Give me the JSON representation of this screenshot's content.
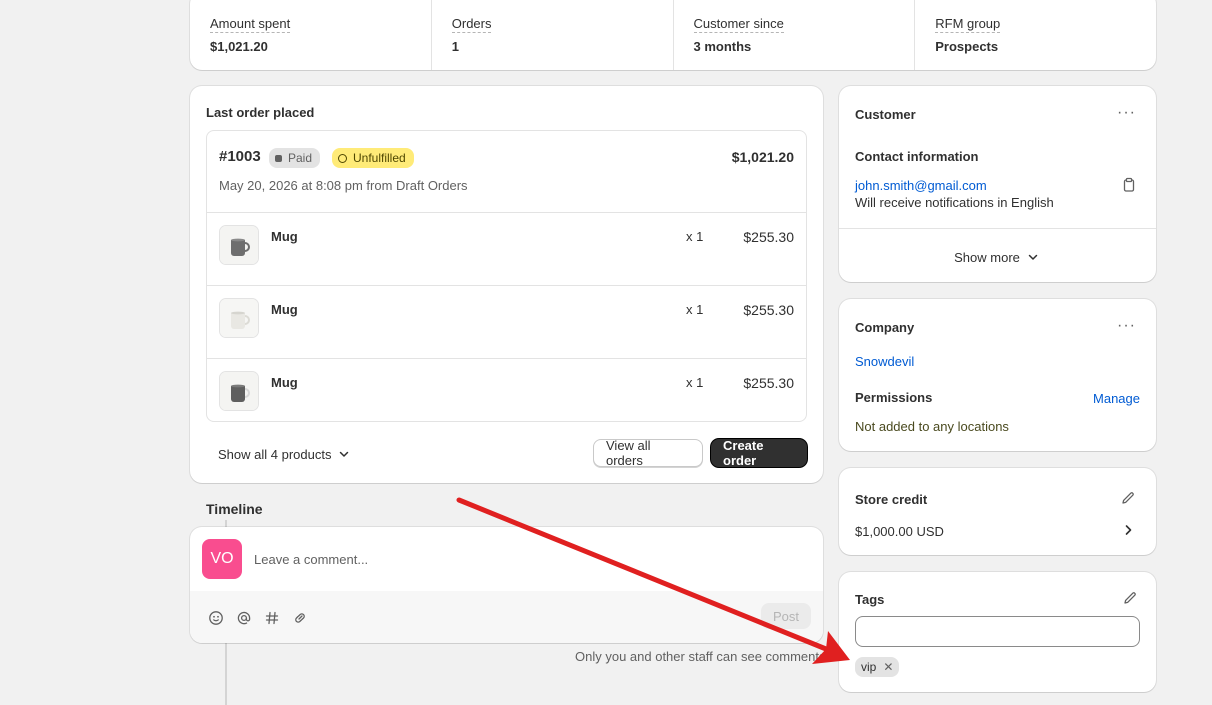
{
  "stats": [
    {
      "label": "Amount spent",
      "value": "$1,021.20"
    },
    {
      "label": "Orders",
      "value": "1"
    },
    {
      "label": "Customer since",
      "value": "3 months"
    },
    {
      "label": "RFM group",
      "value": "Prospects"
    }
  ],
  "last_order": {
    "title": "Last order placed",
    "number": "#1003",
    "payment_badge": "Paid",
    "fulfillment_badge": "Unfulfilled",
    "total": "$1,021.20",
    "date_line": "May 20, 2026 at 8:08 pm from Draft Orders",
    "items": [
      {
        "name": "Mug",
        "qty": "x 1",
        "price": "$255.30",
        "icon": "gray-mug-thumbnail"
      },
      {
        "name": "Mug",
        "qty": "x 1",
        "price": "$255.30",
        "icon": "white-mug-thumbnail"
      },
      {
        "name": "Mug",
        "qty": "x 1",
        "price": "$255.30",
        "icon": "gray-mug-thumbnail"
      }
    ],
    "show_all_label": "Show all 4 products",
    "view_all_label": "View all orders",
    "create_order_label": "Create order"
  },
  "timeline": {
    "title": "Timeline",
    "avatar_initials": "VO",
    "comment_placeholder": "Leave a comment...",
    "post_label": "Post",
    "staff_note": "Only you and other staff can see comments"
  },
  "customer": {
    "title": "Customer",
    "contact_heading": "Contact information",
    "email": "john.smith@gmail.com",
    "notification_note": "Will receive notifications in English",
    "show_more_label": "Show more"
  },
  "company": {
    "title": "Company",
    "name": "Snowdevil",
    "permissions_heading": "Permissions",
    "manage_label": "Manage",
    "permissions_note": "Not added to any locations"
  },
  "store_credit": {
    "title": "Store credit",
    "amount": "$1,000.00 USD"
  },
  "tags": {
    "title": "Tags",
    "input_value": "",
    "chips": [
      "vip"
    ]
  },
  "colors": {
    "accent_link": "#005bd3",
    "primary_button": "#303030",
    "avatar_bg": "#f94d8f",
    "unfulfilled_badge": "#ffeb78",
    "annotation_arrow": "#e02020"
  }
}
